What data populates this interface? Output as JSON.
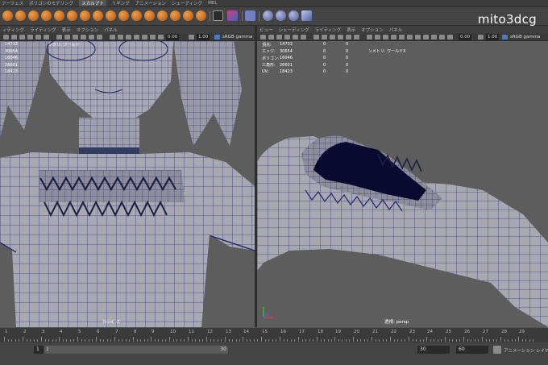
{
  "shelf": {
    "tabs": [
      "ァーフェス",
      "ポリゴンのモデリング",
      "スカルプト",
      "リギング",
      "アニメーション",
      "シェーディング",
      "MEL"
    ],
    "active_tab_index": 2
  },
  "watermark": "mito3dcg",
  "viewport_left": {
    "menu": [
      "ィティング",
      "ライティング",
      "表示",
      "オプション",
      "パネル"
    ],
    "value_a": "0.00",
    "value_b": "1.00",
    "color_space": "sRGB gamma",
    "world_label": "ンタリ: ワールド",
    "stats_values": [
      "14733",
      "30654",
      "16046",
      "26601",
      "18423"
    ],
    "camera_label": "front -Z"
  },
  "viewport_right": {
    "menu": [
      "ビュー",
      "シェーディング",
      "ライティング",
      "表示",
      "オプション",
      "パネル"
    ],
    "value_a": "0.00",
    "value_b": "1.00",
    "color_space": "sRGB gamma",
    "world_label": "ンメトリ: ワールドX",
    "stats": [
      {
        "label": "頂点:",
        "value": "14733",
        "a": "0",
        "b": "0"
      },
      {
        "label": "エッジ:",
        "value": "30654",
        "a": "0",
        "b": "0"
      },
      {
        "label": "ポリゴン:",
        "value": "16046",
        "a": "0",
        "b": "0"
      },
      {
        "label": "三角形:",
        "value": "26601",
        "a": "0",
        "b": "0"
      },
      {
        "label": "UV:",
        "value": "18423",
        "a": "0",
        "b": "0"
      }
    ],
    "camera_label": "透視: persp"
  },
  "timeline": {
    "ticks": [
      "1",
      "2",
      "3",
      "4",
      "5",
      "6",
      "7",
      "8",
      "9",
      "10",
      "11",
      "12",
      "13",
      "14",
      "15",
      "16",
      "17",
      "18",
      "19",
      "20",
      "21",
      "22",
      "23",
      "24",
      "25",
      "26",
      "27",
      "28",
      "29"
    ]
  },
  "range": {
    "start": "1",
    "range_start": "1",
    "range_end": "30",
    "end": "30",
    "anim_end": "60",
    "layer_label": "アニメーション レイヤなし"
  }
}
